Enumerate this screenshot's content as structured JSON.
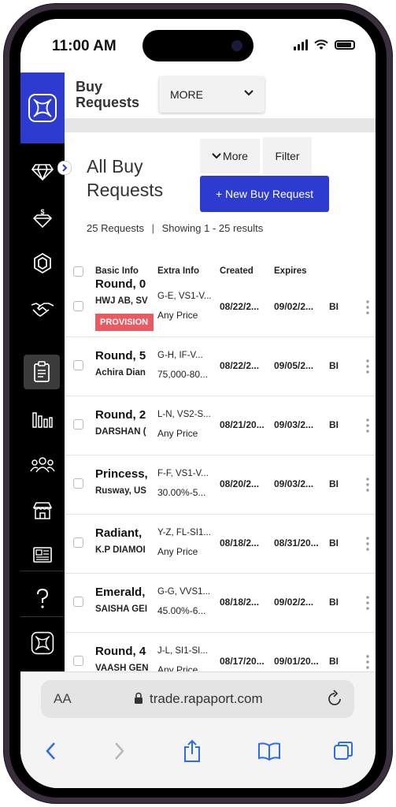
{
  "status": {
    "time": "11:00 AM"
  },
  "header": {
    "title": "Buy Requests",
    "more_label": "MORE"
  },
  "page": {
    "title": "All Buy Requests",
    "more_button": "More",
    "filter_button": "Filter",
    "new_button": "+ New Buy Request",
    "count_text": "25 Requests",
    "showing_text": "Showing 1 - 25 results"
  },
  "table": {
    "headers": {
      "basic": "Basic Info",
      "extra": "Extra Info",
      "created": "Created",
      "expires": "Expires"
    },
    "rows": [
      {
        "name": "Round, 0",
        "company": "HWJ AB, SV",
        "extra1": "G-E, VS1-V...",
        "extra2": "Any Price",
        "created": "08/22/2...",
        "expires": "09/02/2...",
        "type": "BI",
        "badge": "PROVISION"
      },
      {
        "name": "Round, 5",
        "company": "Achira Dian",
        "extra1": "G-H, IF-V...",
        "extra2": "75,000-80...",
        "created": "08/22/2...",
        "expires": "09/05/2...",
        "type": "BI",
        "badge": ""
      },
      {
        "name": "Round, 2",
        "company": "DARSHAN (",
        "extra1": "L-N, VS2-S...",
        "extra2": "Any Price",
        "created": "08/21/20...",
        "expires": "09/03/2...",
        "type": "BI",
        "badge": ""
      },
      {
        "name": "Princess,",
        "company": "Rusway, US",
        "extra1": "F-F, VS1-V...",
        "extra2": "30.00%-5...",
        "created": "08/20/2...",
        "expires": "09/03/2...",
        "type": "BI",
        "badge": ""
      },
      {
        "name": "Radiant,",
        "company": "K.P DIAMOI",
        "extra1": "Y-Z, FL-SI1...",
        "extra2": "Any Price",
        "created": "08/18/2...",
        "expires": "08/31/20...",
        "type": "BI",
        "badge": ""
      },
      {
        "name": "Emerald,",
        "company": "SAISHA GEI",
        "extra1": "G-G, VVS1...",
        "extra2": "45.00%-6...",
        "created": "08/18/2...",
        "expires": "09/02/2...",
        "type": "BI",
        "badge": ""
      },
      {
        "name": "Round, 4",
        "company": "VAASH GEN",
        "extra1": "J-L, SI1-SI...",
        "extra2": "Any Price",
        "created": "08/17/20...",
        "expires": "09/01/20...",
        "type": "BI",
        "badge": ""
      }
    ]
  },
  "browser": {
    "aa": "AA",
    "url": "trade.rapaport.com"
  },
  "sidebar": {
    "icons": [
      "diamond-icon",
      "loose-diamond-icon",
      "gem-icon",
      "handshake-icon",
      "clipboard-icon",
      "bar-chart-icon",
      "people-icon",
      "store-icon",
      "newspaper-icon",
      "help-icon",
      "rapaport-logo-icon"
    ]
  },
  "colors": {
    "brand": "#2d3bd1",
    "badge": "#e95b63",
    "sidebar": "#000000"
  }
}
